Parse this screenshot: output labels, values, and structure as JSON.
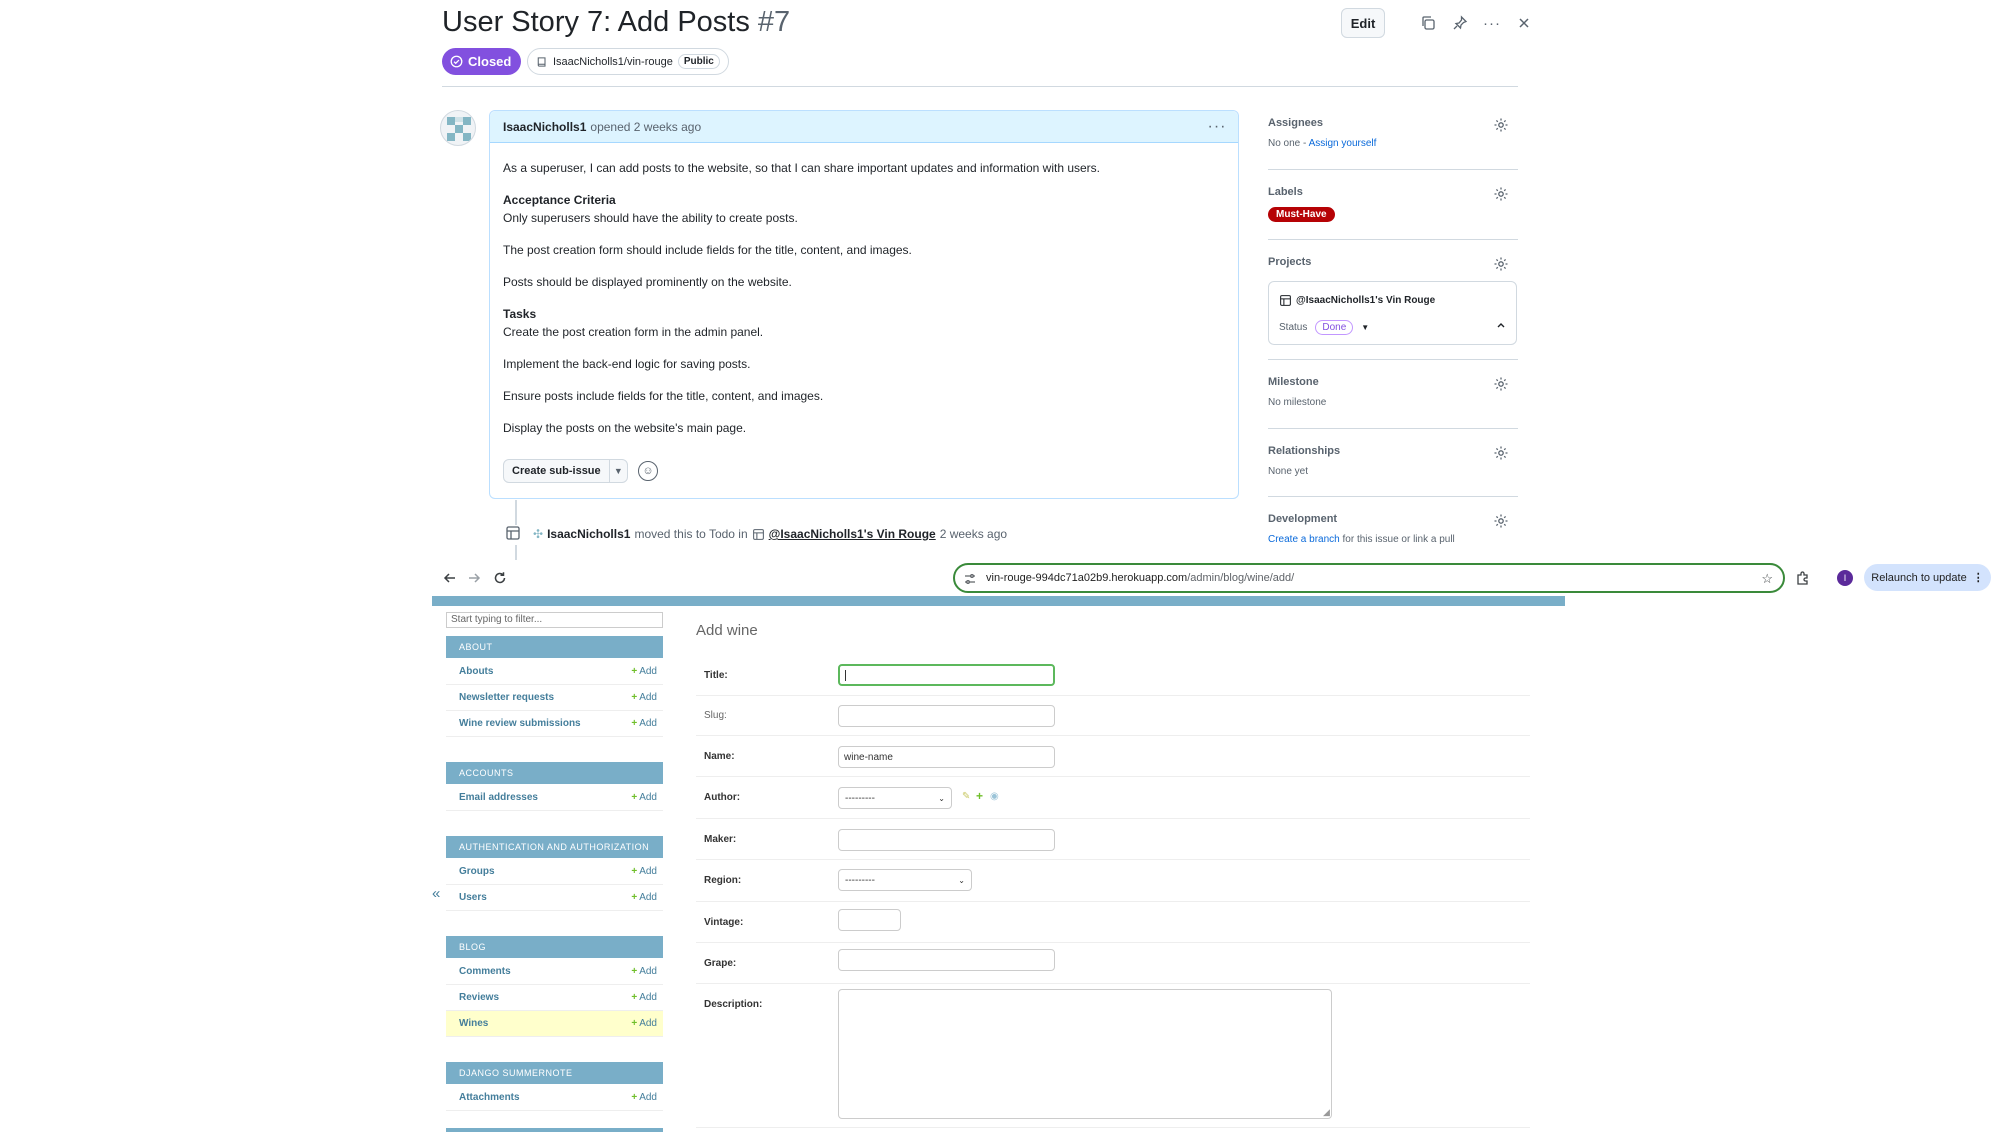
{
  "issue": {
    "title": "User Story 7: Add Posts",
    "number": "#7",
    "edit_label": "Edit",
    "state": "Closed",
    "repo": "IsaacNicholls1/vin-rouge",
    "visibility": "Public"
  },
  "comment": {
    "author": "IsaacNicholls1",
    "meta": "opened 2 weeks ago",
    "intro": "As a superuser, I can add posts to the website, so that I can share important updates and information with users.",
    "criteria_heading": "Acceptance Criteria",
    "criteria": [
      "Only superusers should have the ability to create posts.",
      "The post creation form should include fields for the title, content, and images.",
      "Posts should be displayed prominently on the website."
    ],
    "tasks_heading": "Tasks",
    "tasks": [
      "Create the post creation form in the admin panel.",
      "Implement the back-end logic for saving posts.",
      "Ensure posts include fields for the title, content, and images.",
      "Display the posts on the website's main page."
    ],
    "subissue_label": "Create sub-issue"
  },
  "timeline": {
    "author": "IsaacNicholls1",
    "action": "moved this to Todo in",
    "project": "@IsaacNicholls1's Vin Rouge",
    "time": "2 weeks ago"
  },
  "sidebar": {
    "assignees": {
      "title": "Assignees",
      "value": "No one - ",
      "link": "Assign yourself"
    },
    "labels": {
      "title": "Labels",
      "chip": "Must-Have",
      "chip_color": "#b60205"
    },
    "projects": {
      "title": "Projects",
      "name": "@IsaacNicholls1's Vin Rouge",
      "status_label": "Status",
      "status": "Done"
    },
    "milestone": {
      "title": "Milestone",
      "value": "No milestone"
    },
    "relationships": {
      "title": "Relationships",
      "value": "None yet"
    },
    "development": {
      "title": "Development",
      "link": "Create a branch",
      "value": "for this issue or link a pull"
    }
  },
  "browser": {
    "url_host": "vin-rouge-994dc71a02b9.herokuapp.com",
    "url_path": "/admin/blog/wine/add/",
    "profile_initial": "I",
    "relaunch_label": "Relaunch to update"
  },
  "admin_nav": {
    "filter_placeholder": "Start typing to filter...",
    "add_label": "Add",
    "collapse": "«",
    "apps": [
      {
        "caption": "ABOUT",
        "models": [
          "Abouts",
          "Newsletter requests",
          "Wine review submissions"
        ]
      },
      {
        "caption": "ACCOUNTS",
        "models": [
          "Email addresses"
        ]
      },
      {
        "caption": "AUTHENTICATION AND AUTHORIZATION",
        "models": [
          "Groups",
          "Users"
        ]
      },
      {
        "caption": "BLOG",
        "models": [
          "Comments",
          "Reviews",
          "Wines"
        ]
      },
      {
        "caption": "DJANGO SUMMERNOTE",
        "models": [
          "Attachments"
        ]
      }
    ]
  },
  "form": {
    "title": "Add wine",
    "fields": {
      "title": {
        "label": "Title:",
        "value": ""
      },
      "slug": {
        "label": "Slug:",
        "value": ""
      },
      "name": {
        "label": "Name:",
        "value": "wine-name"
      },
      "author": {
        "label": "Author:",
        "value": "---------"
      },
      "maker": {
        "label": "Maker:",
        "value": ""
      },
      "region": {
        "label": "Region:",
        "value": "---------"
      },
      "vintage": {
        "label": "Vintage:",
        "value": ""
      },
      "grape": {
        "label": "Grape:",
        "value": ""
      },
      "description": {
        "label": "Description:",
        "value": ""
      }
    }
  }
}
